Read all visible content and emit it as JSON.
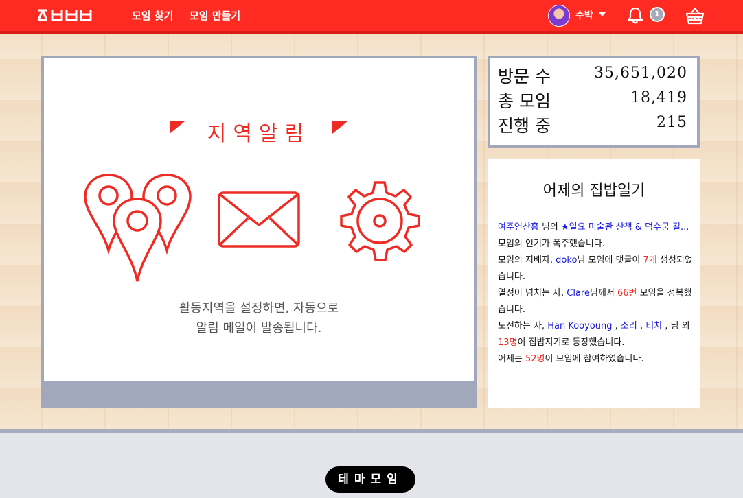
{
  "header": {
    "logo_text": "ㅈㅂㅂㅂ",
    "nav": [
      "모임 찾기",
      "모임 만들기"
    ],
    "username": "수박",
    "notification_count": "1",
    "colors": {
      "brand": "#ff2b22"
    }
  },
  "slider": {
    "title": "지역알림",
    "description_line1": "활동지역을 설정하면, 자동으로",
    "description_line2": "알림 메일이 발송됩니다.",
    "slide_count": 3,
    "active_index": 0
  },
  "stats": [
    {
      "label": "방문 수",
      "value": "35,651,020"
    },
    {
      "label": "총 모임",
      "value": "18,419"
    },
    {
      "label": "진행 중",
      "value": "215"
    }
  ],
  "diary": {
    "title": "어제의 집밥일기",
    "p1": {
      "user": "여주연산홍",
      "t1": " 님의 ",
      "meetup": "★일요 미술관 산책 & 덕수궁 길...",
      "t2": " 모임의 인기가 폭주했습니다."
    },
    "p2": {
      "t1": "모임의 지배자, ",
      "user": "doko",
      "t2": "님 모임에 댓글이 ",
      "count": "7개",
      "t3": " 생성되었습니다."
    },
    "p3": {
      "t1": "열정이 넘치는 자, ",
      "user": "Clare",
      "t2": "님께서 ",
      "count": "66번",
      "t3": " 모임을 정복했습니다."
    },
    "p4": {
      "t1": "도전하는 자, ",
      "user1": "Han Kooyoung",
      "sep1": " , ",
      "user2": "소리",
      "sep2": " , ",
      "user3": "티치",
      "t2": " , 님 외 ",
      "count": "13명",
      "t3": "이 집밥지기로 등장했습니다."
    },
    "p5": {
      "t1": "어제는 ",
      "count": "52명",
      "t2": "이 모임에 참여하였습니다."
    }
  },
  "section": {
    "theme_button": "테마모임"
  }
}
